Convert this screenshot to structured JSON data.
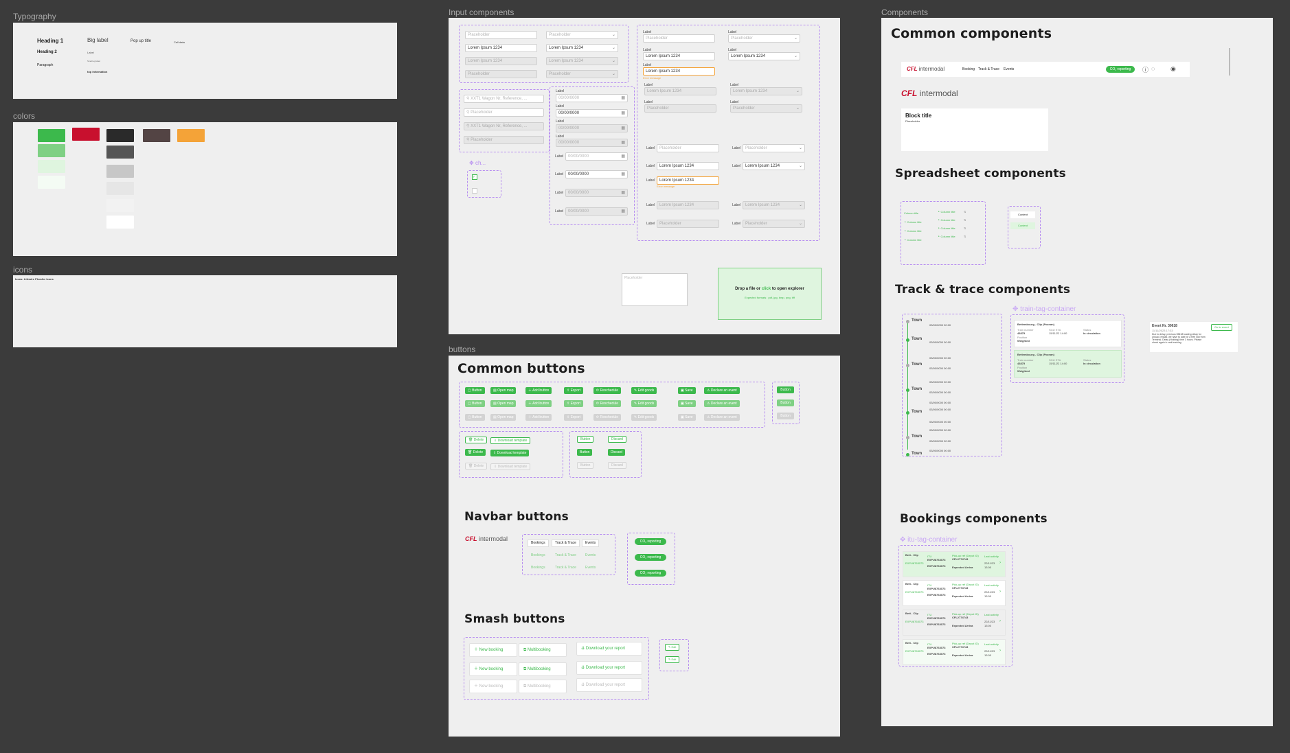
{
  "frames": {
    "typography": "Typography",
    "colors": "colors",
    "icons": "icons",
    "inputs": "Input components",
    "buttons": "buttons",
    "components": "Components"
  },
  "typography": {
    "heading1": "Heading 1",
    "heading2": "Heading 2",
    "paragraph": "Paragraph",
    "big_label": "Big label",
    "label": "Label",
    "small_label": "Small eg label",
    "top_information": "top information",
    "popup_title": "Pop up title",
    "cell_data": "Cell data"
  },
  "icons_text": "Icons: Lifewire Phosfor Icons",
  "colors": {
    "green": [
      "#3cb94c",
      "#7fd084",
      "#dff5df",
      "#f4fbf4"
    ],
    "red": "#c8102e",
    "grays": [
      "#2a2a2a",
      "#555555",
      "#c7c7c7",
      "#e6e6e6",
      "#f2f2f2",
      "#ffffff"
    ],
    "brown": "#534444",
    "orange": "#f4a338"
  },
  "inputs": {
    "placeholder": "Placeholder",
    "value": "Lorem Ipsum 1234",
    "label": "Label",
    "date_placeholder": "00/00/0000",
    "date_value": "00/00/0000",
    "search1": "XXT1 Wagon Nr, Reference, ...",
    "search2": "Placeholder",
    "search3": "XXT1 Wagon Nr, Reference, ...",
    "search4": "Placeholder",
    "check_title": "ch...",
    "error_text": "Error message",
    "textarea_placeholder": "Placeholder",
    "drop_text_pre": "Drop a file or ",
    "drop_link": "click",
    "drop_text_post": " to open explorer",
    "drop_formats": "Expected formats : pdf, jpg, bmp, png, tiff"
  },
  "buttons": {
    "common_title": "Common buttons",
    "row_labels": [
      "Button",
      "Open map",
      "Add button",
      "Export",
      "Reschedule",
      "Edit goods",
      "Save",
      "Declare an event"
    ],
    "single": "Button",
    "delete": "Delete",
    "download_template": "Download template",
    "discard": "Discard",
    "navbar_title": "Navbar buttons",
    "nav_items": [
      "Bookings",
      "Track & Trace",
      "Events"
    ],
    "co2": "CO₂ reporting",
    "smash_title": "Smash buttons",
    "new_booking": "New booking",
    "multibooking": "Multibooking",
    "download_report": "Download your report",
    "edit": "Edit"
  },
  "logo": {
    "cfl": "CFL",
    "rest": "intermodal"
  },
  "components": {
    "common_title": "Common components",
    "nav_items": [
      "Booking",
      "Track & Trace",
      "Events"
    ],
    "co2": "CO₂ reporting",
    "block_title": "Block title",
    "block_placeholder": "Placeholder",
    "spreadsheet_title": "Spreadsheet components",
    "column_title": "Column title",
    "content": "Content",
    "track_title": "Track & trace components",
    "train_tag": "train-tag-container",
    "town": "Town",
    "tl_date": "03/00/0000 00:00",
    "train_route": "Bettembourg - Clip (Poznan)",
    "train_number_label": "Train number",
    "train_number": "43875",
    "sgu_label": "SGU ETA",
    "sgu_value": "15/11/22 14:00",
    "status_label": "Status",
    "status_value": "In circulation",
    "position_label": "Position",
    "weighted_label": "Weighted",
    "event_title": "Event Nr. 30618",
    "event_date": "11/11/2023 17:33",
    "event_desc": "Due to delay, previous 35618 loading delay for unload, reload, we have to wait for a free slot from Terminal. Delay (Holding) time 3 hours. Please check again in real-tracking.",
    "go_event": "Go to event",
    "bookings_title": "Bookings components",
    "itu_tag": "itu-tag-container",
    "b_route": "Bett - Clip",
    "b_itu_label": "ITU",
    "b_itu": "EXPU8763073",
    "b_pick_label": "Pick-up ref (Depot ID)",
    "b_pick": "CFL2774743",
    "b_expected": "Expected Arriva",
    "b_last": "Last activity",
    "b_date": "22/11/23",
    "b_time": "13:00"
  }
}
